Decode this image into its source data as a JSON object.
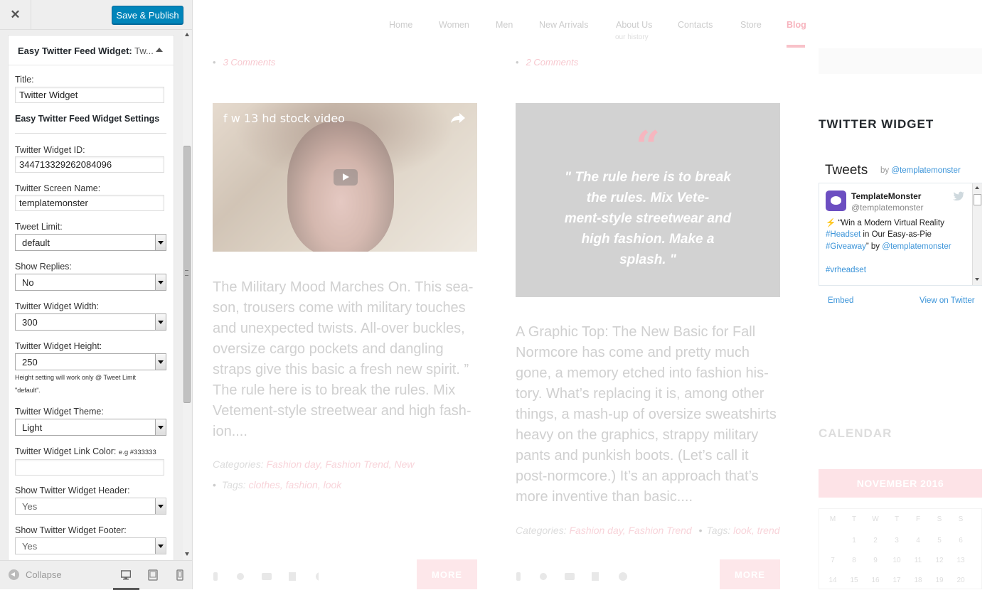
{
  "panel": {
    "close_label": "✕",
    "save_label": "Save & Publish",
    "widget_title": "Easy Twitter Feed Widget:",
    "widget_title_suffix": "Tw...",
    "fields": {
      "title_label": "Title:",
      "title_value": "Twitter Widget",
      "settings_heading": "Easy Twitter Feed Widget Settings",
      "widget_id_label": "Twitter Widget ID:",
      "widget_id_value": "344713329262084096",
      "screen_name_label": "Twitter Screen Name:",
      "screen_name_value": "templatemonster",
      "tweet_limit_label": "Tweet Limit:",
      "tweet_limit_value": "default",
      "show_replies_label": "Show Replies:",
      "show_replies_value": "No",
      "width_label": "Twitter Widget Width:",
      "width_value": "300",
      "height_label": "Twitter Widget Height:",
      "height_value": "250",
      "height_hint_line1": "Height setting will work only @ Tweet Limit",
      "height_hint_line2": "\"default\".",
      "theme_label": "Twitter Widget Theme:",
      "theme_value": "Light",
      "link_color_label": "Twitter Widget Link Color:",
      "link_color_hint": "e.g #333333",
      "link_color_value": "",
      "show_header_label": "Show Twitter Widget Header:",
      "show_header_value": "Yes",
      "show_footer_label": "Show Twitter Widget Footer:",
      "show_footer_value": "Yes"
    },
    "collapse_label": "Collapse",
    "devices": [
      "desktop-icon",
      "tablet-icon",
      "mobile-icon"
    ]
  },
  "preview": {
    "nav": [
      {
        "label": "Home"
      },
      {
        "label": "Women"
      },
      {
        "label": "Men"
      },
      {
        "label": "New Arrivals"
      },
      {
        "label": "About Us",
        "sub": "our history"
      },
      {
        "label": "Contacts"
      },
      {
        "label": "Store"
      },
      {
        "label": "Blog",
        "active": true
      }
    ],
    "post1": {
      "comments": "3 Comments",
      "video_title": "f w 13 hd stock video",
      "excerpt": "The Military Mood Marches On. This sea-\nson, trousers come with military touches\nand unexpected twists. All-over buckles,\noversize cargo pockets and dangling\nstraps give this basic a fresh new spirit. ”\nThe rule here is to break the rules. Mix\nVetement-style streetwear and high fash-\nion....",
      "categories_label": "Categories:",
      "categories": "Fashion day, Fashion Trend, New",
      "tags_label": "Tags:",
      "tags": "clothes, fashion, look",
      "more_label": "MORE"
    },
    "post2": {
      "comments": "2 Comments",
      "quote_mark": "“",
      "quote": "\" The rule here is to break\nthe rules. Mix Vete-\nment-style streetwear and\nhigh fashion. Make a\nsplash. \"",
      "excerpt": "A Graphic Top: The New Basic for Fall\nNormcore has come and pretty much\ngone, a memory etched into fashion his-\ntory. What’s replacing it is, among other\nthings, a mash-up of oversize sweatshirts\nheavy on the graphics, strappy military\npants and punkish boots. (Let’s call it\npost-normcore.) It’s an approach that’s\nmore inventive than basic....",
      "categories_label": "Categories:",
      "categories": "Fashion day, Fashion Trend",
      "tags_label": "Tags:",
      "tags": "look, trend",
      "more_label": "MORE"
    },
    "sidebar": {
      "twitter_title": "TWITTER WIDGET",
      "tweets_label": "Tweets",
      "by_label": "by",
      "by_handle": "@templatemonster",
      "tweet": {
        "name": "TemplateMonster",
        "handle": "@templatemonster",
        "bolt": "⚡",
        "text_1": " “Win a Modern Virtual Reality",
        "tag_1": "#Headset",
        "text_2": " in Our Easy-as-Pie",
        "tag_2": "#Giveaway",
        "text_3": "” by ",
        "mention": "@templatemonster",
        "tag_3": "#vrheadset"
      },
      "embed_label": "Embed",
      "view_label": "View on Twitter",
      "calendar_title": "CALENDAR",
      "calendar_month": "NOVEMBER 2016",
      "calendar_days": [
        "M",
        "T",
        "W",
        "T",
        "F",
        "S",
        "S"
      ],
      "calendar_rows": [
        [
          "",
          "1",
          "2",
          "3",
          "4",
          "5",
          "6"
        ],
        [
          "7",
          "8",
          "9",
          "10",
          "11",
          "12",
          "13"
        ],
        [
          "14",
          "15",
          "16",
          "17",
          "18",
          "19",
          "20"
        ]
      ]
    }
  },
  "colors": {
    "primary_button": "#0085ba",
    "accent_pink": "#f8c2c9",
    "twitter_link": "#3b94d9"
  }
}
